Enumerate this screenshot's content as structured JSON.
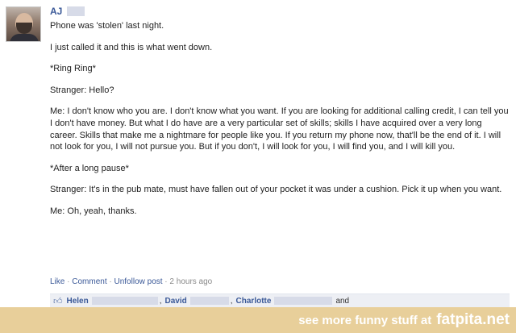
{
  "post": {
    "author": "AJ",
    "status": "Phone was 'stolen' last night.",
    "paragraphs": [
      "I just called it and this is what went down.",
      "*Ring Ring*",
      "Stranger: Hello?",
      "Me: I don't know who you are. I don't know what you want. If you are looking for additional calling credit, I can tell you I don't have money. But what I do have are a very particular set of skills; skills I have acquired over a very long career. Skills that make me a nightmare for people like you. If you return my phone now, that'll be the end of it. I will not look for you, I will not pursue you. But if you don't, I will look for you, I will find you, and I will kill you.",
      "*After a long pause*",
      "Stranger: It's in the pub mate, must have fallen out of your pocket it was under a cushion. Pick it up when you want.",
      "Me: Oh, yeah, thanks."
    ],
    "actions": {
      "like": "Like",
      "sep": " · ",
      "comment": "Comment",
      "unfollow": "Unfollow post",
      "time": "2 hours ago"
    },
    "likes": {
      "names": [
        "Helen",
        "David",
        "Charlotte"
      ],
      "comma": ",",
      "and": "and"
    }
  },
  "footer": {
    "lead": "see more funny stuff at",
    "brand": "fatpita.net"
  }
}
